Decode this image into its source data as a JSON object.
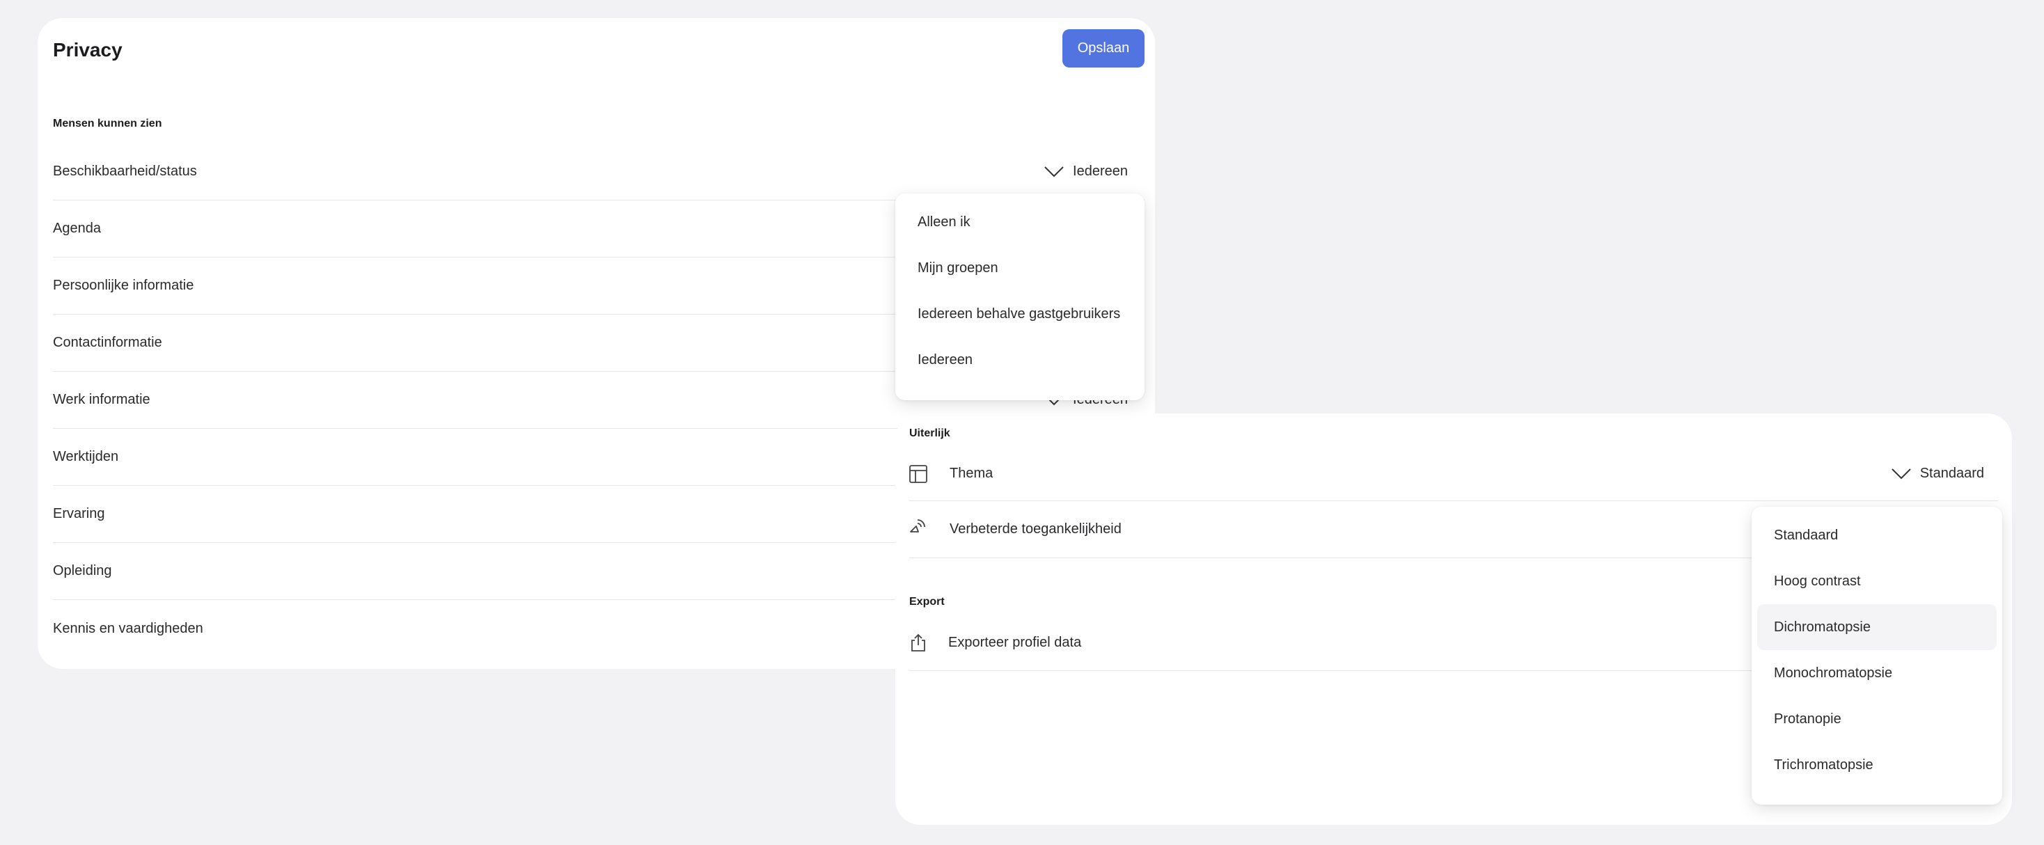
{
  "privacy": {
    "title": "Privacy",
    "save_label": "Opslaan",
    "section_heading": "Mensen kunnen zien",
    "rows": [
      {
        "label": "Beschikbaarheid/status",
        "value": "Iedereen"
      },
      {
        "label": "Agenda",
        "value": ""
      },
      {
        "label": "Persoonlijke informatie",
        "value": ""
      },
      {
        "label": "Contactinformatie",
        "value": ""
      },
      {
        "label": "Werk informatie",
        "value": "Iedereen"
      },
      {
        "label": "Werktijden",
        "value": ""
      },
      {
        "label": "Ervaring",
        "value": ""
      },
      {
        "label": "Opleiding",
        "value": ""
      },
      {
        "label": "Kennis en vaardigheden",
        "value": ""
      }
    ],
    "visibility_dropdown": {
      "options": [
        "Alleen ik",
        "Mijn groepen",
        "Iedereen behalve gastgebruikers",
        "Iedereen"
      ]
    }
  },
  "appearance": {
    "section_heading": "Uiterlijk",
    "theme_row": {
      "label": "Thema",
      "value": "Standaard",
      "icon": "layout-icon"
    },
    "accessibility_row": {
      "label": "Verbeterde toegankelijkheid",
      "icon": "accessibility-icon"
    },
    "export_heading": "Export",
    "export_row": {
      "label": "Exporteer profiel data",
      "icon": "share-icon"
    },
    "theme_dropdown": {
      "options": [
        "Standaard",
        "Hoog contrast",
        "Dichromatopsie",
        "Monochromatopsie",
        "Protanopie",
        "Trichromatopsie"
      ],
      "hovered": "Dichromatopsie"
    }
  },
  "colors": {
    "accent": "#5274e0",
    "background": "#f2f2f4",
    "card": "#ffffff"
  }
}
